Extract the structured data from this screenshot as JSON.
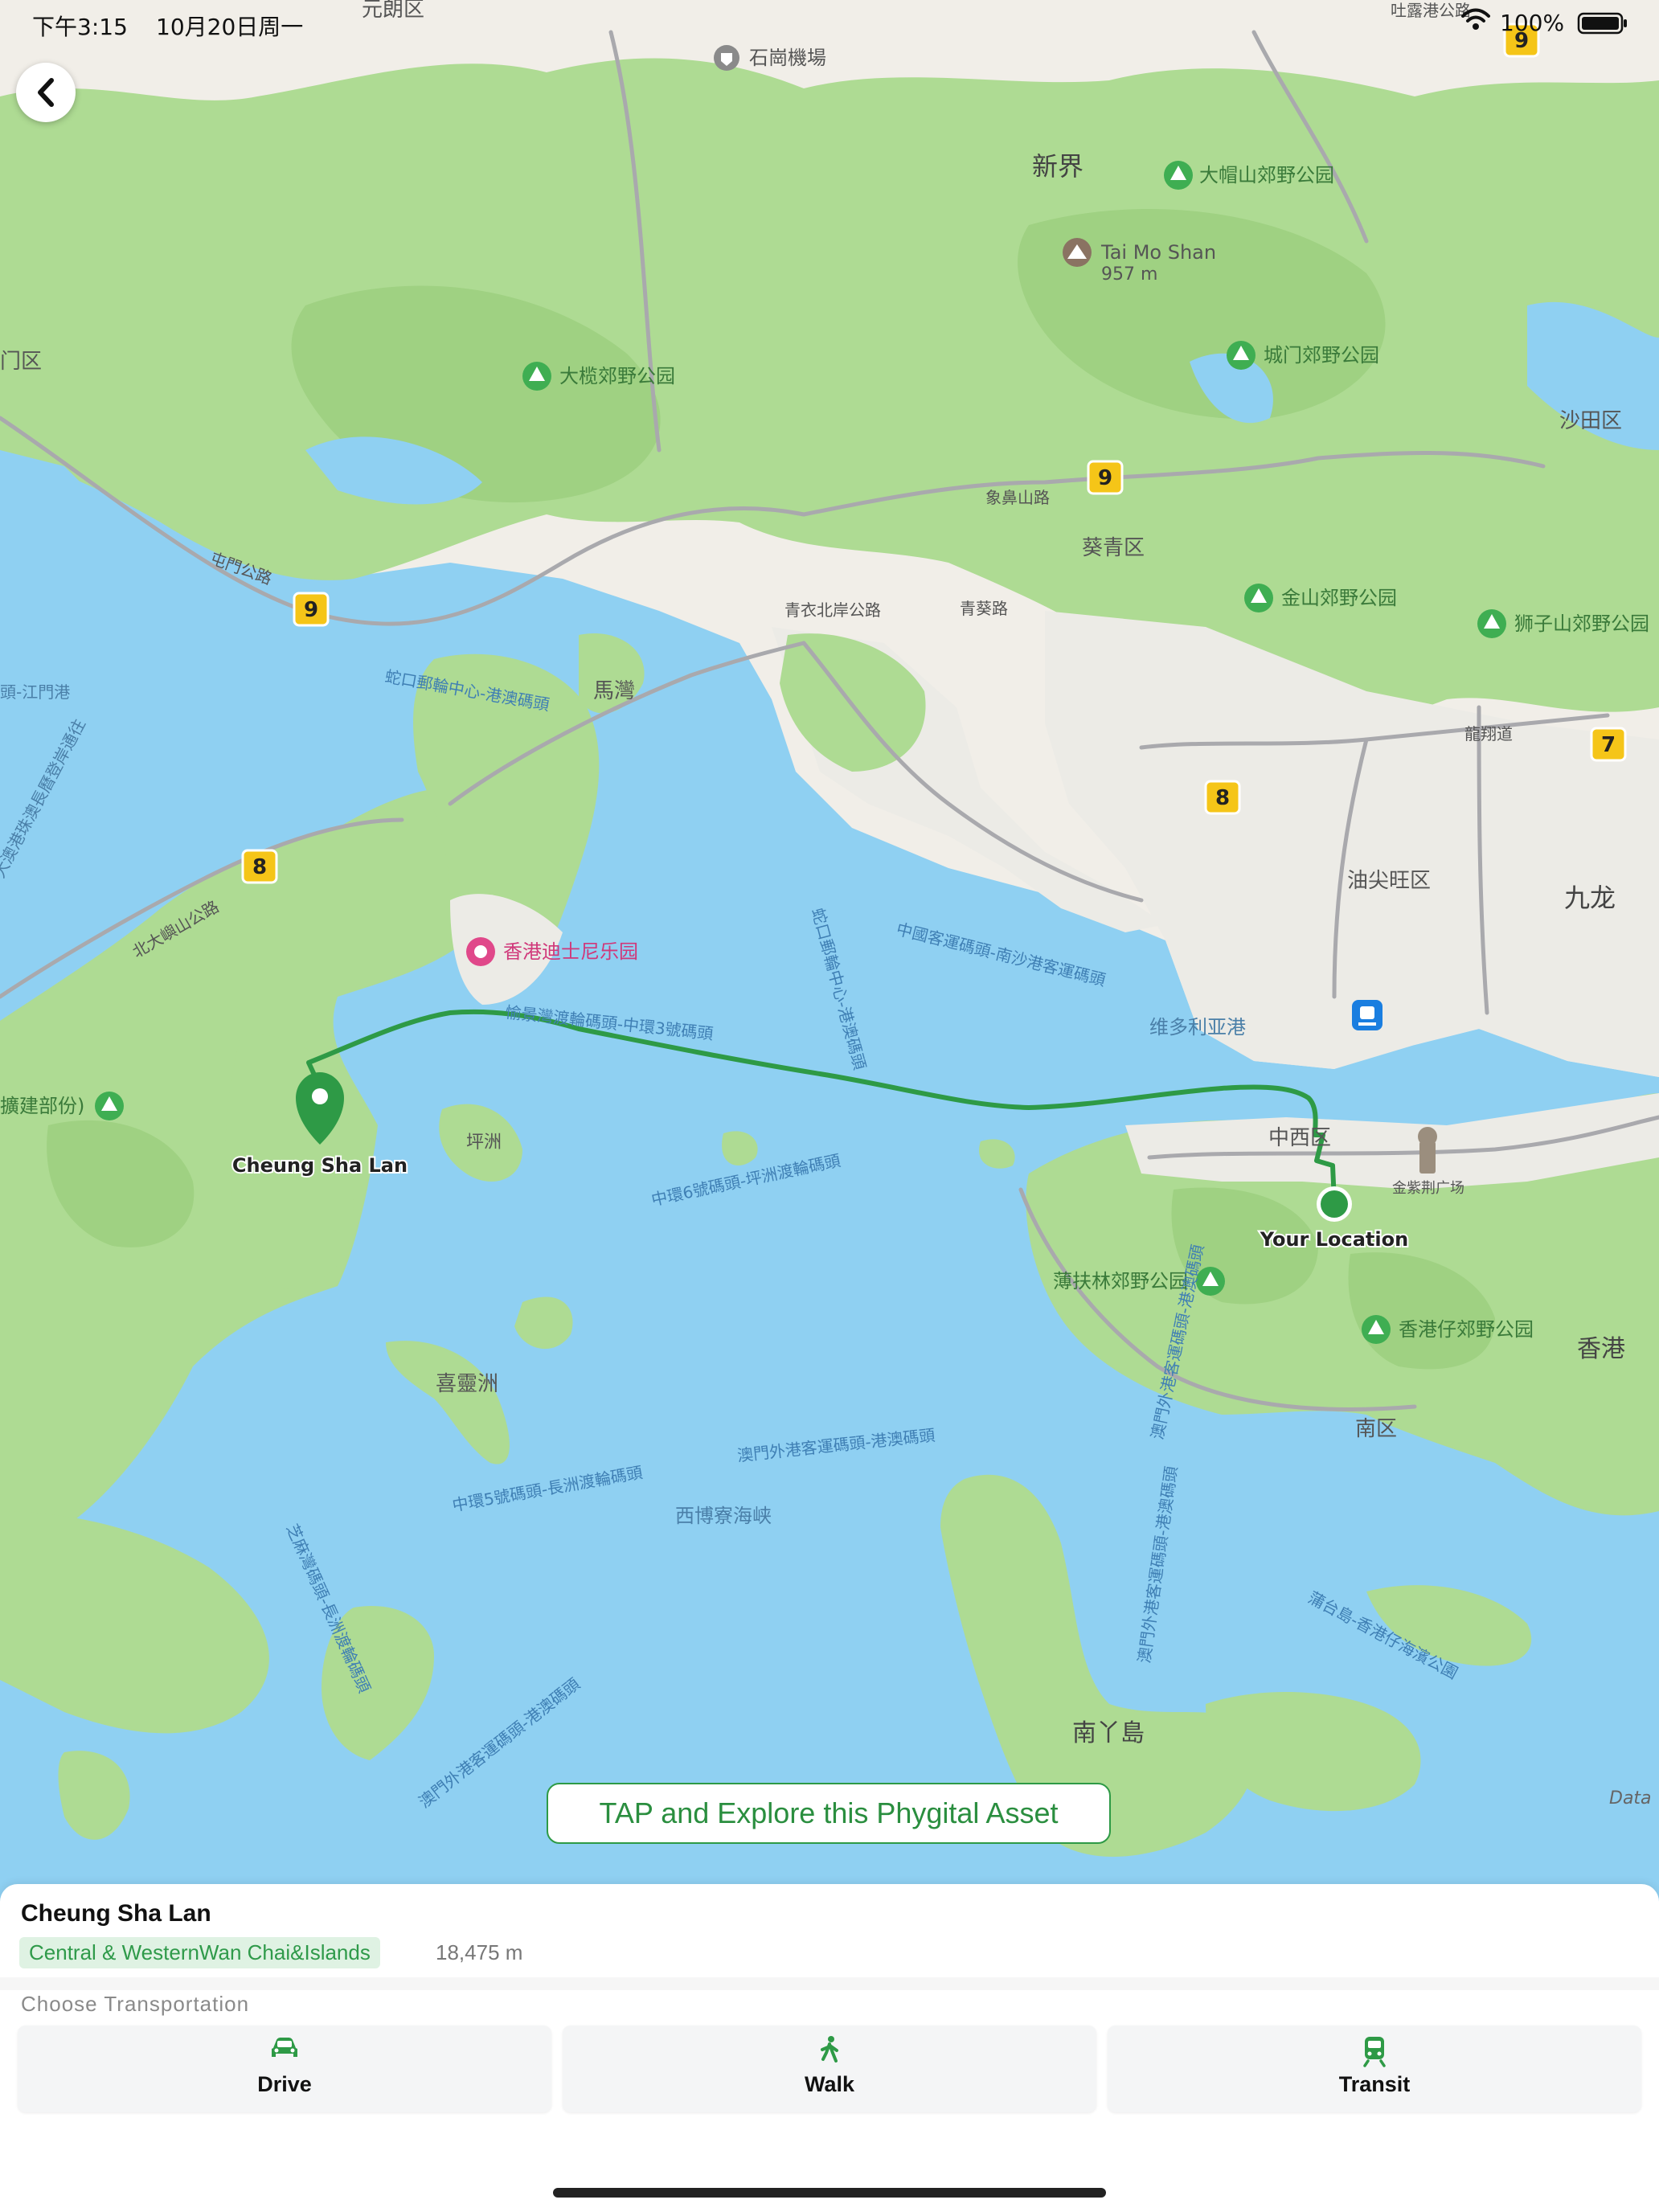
{
  "status_bar": {
    "time": "下午3:15",
    "date": "10月20日周一",
    "battery": "100%"
  },
  "map": {
    "places": {
      "yuen_long": "元朗区",
      "airport": "石崗機場",
      "tuen_mun": "门区",
      "new_territories": "新界",
      "tai_mo_shan": "Tai Mo Shan",
      "tai_mo_shan_height": "957 m",
      "ma_wan": "馬灣",
      "sha_tin": "沙田区",
      "kwai_tsing": "葵青区",
      "yau_tsim_mong": "油尖旺区",
      "kowloon": "九龙",
      "victoria_harbour": "维多利亚港",
      "central_western": "中西区",
      "southern": "南区",
      "hong_kong": "香港",
      "peng_chau": "坪洲",
      "hei_ling_chau": "喜靈洲",
      "lamma": "南丫島",
      "west_lamma": "西博寮海峡",
      "golden_bauhinia": "金紫荆广场",
      "data_partial": "Data"
    },
    "parks": {
      "tai_mo_shan_park": "大帽山郊野公园",
      "tai_lam_park": "大榄郊野公园",
      "shing_mun_park": "城门郊野公园",
      "kam_shan_park": "金山郊野公园",
      "lion_rock_park": "狮子山郊野公园",
      "pok_fu_lam_park": "薄扶林郊野公园",
      "aberdeen_park": "香港仔郊野公园",
      "lantau_park": "擴建部份)"
    },
    "poi": {
      "disneyland": "香港迪士尼乐园"
    },
    "roads": {
      "castle_peak_road": "屯門公路",
      "tsing_yi_north": "青衣北岸公路",
      "tsing_road": "青葵路",
      "cheung_ping_road": "象鼻山路",
      "lung_cheung": "龍翔道",
      "tuen_mun_pier": "吐露港公路",
      "north_lantau": "北大嶼山公路",
      "jiangmen": "頭-江門港",
      "zhuhai": "-大澳港珠澳長曆登岸通往"
    },
    "ferries": {
      "f1": "蛇口郵輪中心-港澳碼頭",
      "f2": "愉景灣渡輪碼頭-中環3號碼頭",
      "f3": "蛇口郵輪中心-港澳碼頭",
      "f4": "中國客運碼頭-南沙港客運碼頭",
      "f5": "中環6號碼頭-坪洲渡輪碼頭",
      "f6": "中環5號碼頭-長洲渡輪碼頭",
      "f7": "澳門外港客運碼頭-港澳碼頭",
      "f8": "澳門外港客運碼頭-港澳碼頭",
      "f9": "澳門外港客運碼頭-港澳碼頭",
      "f10": "芝麻灣碼頭-長洲渡輪碼頭",
      "f11": "澳門外港客運碼頭-港澳碼頭",
      "f12": "蒲台島-香港仔海濱公園"
    },
    "shields": {
      "r9a": "9",
      "r9b": "9",
      "r9c": "9",
      "r8a": "8",
      "r8b": "8",
      "r7": "7"
    },
    "destination_label": "Cheung Sha Lan",
    "current_label": "Your Location",
    "colors": {
      "water": "#8fd0f2",
      "land": "#f2efe9",
      "park": "#aedb93",
      "route": "#2e9a46"
    }
  },
  "cta": {
    "label": "TAP and Explore this Phygital Asset"
  },
  "sheet": {
    "title": "Cheung Sha Lan",
    "districts": "Central & WesternWan Chai&Islands",
    "distance": "18,475 m",
    "choose_label": "Choose Transportation",
    "modes": [
      {
        "label": "Drive",
        "icon": "car-icon"
      },
      {
        "label": "Walk",
        "icon": "walk-icon"
      },
      {
        "label": "Transit",
        "icon": "train-icon"
      }
    ]
  }
}
